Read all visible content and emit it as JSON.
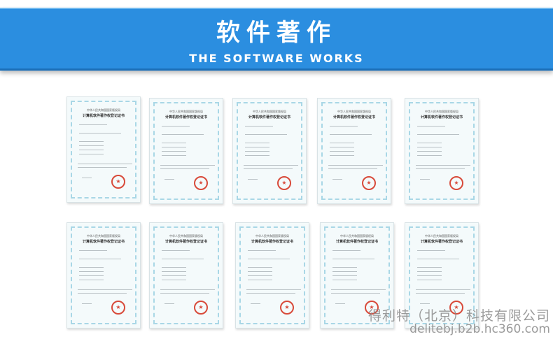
{
  "banner": {
    "title": "软件著作",
    "subtitle": "THE SOFTWARE WORKS"
  },
  "certificates": [
    {
      "issuer": "中华人民共和国国家版权局",
      "name": "计算机软件著作权登记证书"
    },
    {
      "issuer": "中华人民共和国国家版权局",
      "name": "计算机软件著作权登记证书"
    },
    {
      "issuer": "中华人民共和国国家版权局",
      "name": "计算机软件著作权登记证书"
    },
    {
      "issuer": "中华人民共和国国家版权局",
      "name": "计算机软件著作权登记证书"
    },
    {
      "issuer": "中华人民共和国国家版权局",
      "name": "计算机软件著作权登记证书"
    },
    {
      "issuer": "中华人民共和国国家版权局",
      "name": "计算机软件著作权登记证书"
    },
    {
      "issuer": "中华人民共和国国家版权局",
      "name": "计算机软件著作权登记证书"
    },
    {
      "issuer": "中华人民共和国国家版权局",
      "name": "计算机软件著作权登记证书"
    },
    {
      "issuer": "中华人民共和国国家版权局",
      "name": "计算机软件著作权登记证书"
    },
    {
      "issuer": "中华人民共和国国家版权局",
      "name": "计算机软件著作权登记证书"
    }
  ],
  "watermark": {
    "company": "得利特（北京）科技有限公司",
    "url": "delitebj.b2b.hc360.com"
  },
  "colors": {
    "banner_blue": "#2b8ee0",
    "seal_red": "#d84a3a",
    "cert_border": "#a9d7e6"
  }
}
